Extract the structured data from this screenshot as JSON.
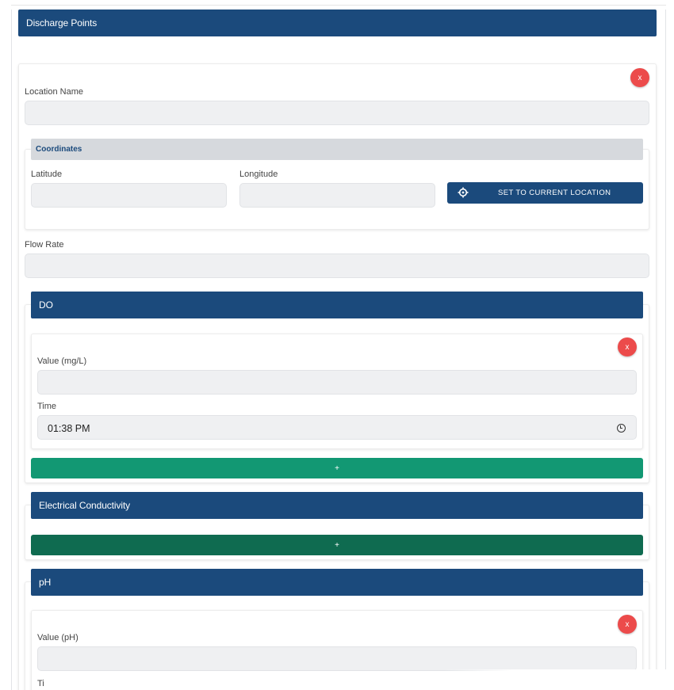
{
  "page": {
    "title": "Discharge Points"
  },
  "discharge_point": {
    "remove_label": "x",
    "location_name": {
      "label": "Location Name",
      "value": ""
    },
    "coordinates": {
      "header": "Coordinates",
      "latitude": {
        "label": "Latitude",
        "value": ""
      },
      "longitude": {
        "label": "Longitude",
        "value": ""
      },
      "set_location_button": "SET TO CURRENT LOCATION"
    },
    "flow_rate": {
      "label": "Flow Rate",
      "value": ""
    }
  },
  "do_section": {
    "title": "DO",
    "entry": {
      "remove_label": "x",
      "value_label": "Value (mg/L)",
      "value": "",
      "time_label": "Time",
      "time_value": "01:38 PM"
    },
    "add_label": "+"
  },
  "ec_section": {
    "title": "Electrical Conductivity",
    "add_label": "+"
  },
  "ph_section": {
    "title": "pH",
    "entry": {
      "remove_label": "x",
      "value_label": "Value (pH)",
      "value": "",
      "time_label": "Ti"
    }
  },
  "colors": {
    "header_blue": "#1b4a7c",
    "add_green": "#129873",
    "add_green_dark": "#0f6b50",
    "remove_red": "#ec4b4b",
    "field_bg": "#eff0f2"
  },
  "icons": {
    "remove": "close-icon",
    "locate": "crosshair-icon",
    "clock": "clock-icon"
  }
}
